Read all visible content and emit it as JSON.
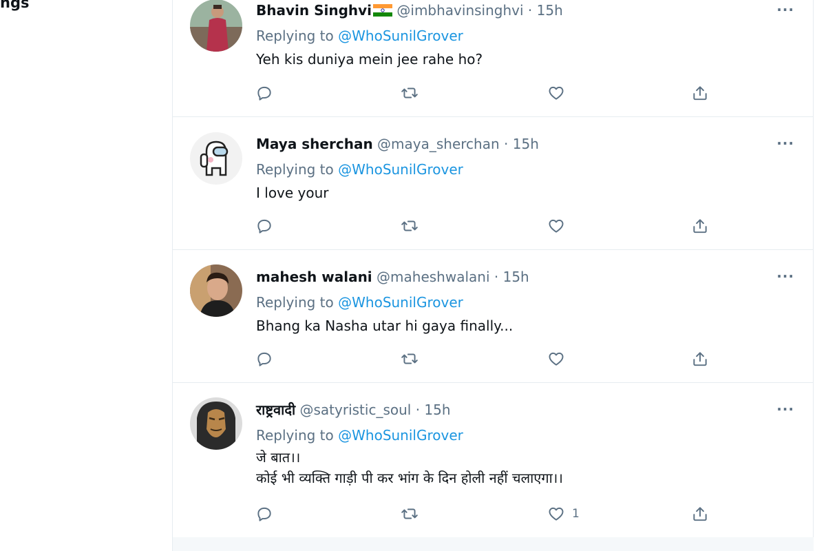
{
  "left_fragment": "ngs",
  "tweets": [
    {
      "name": "Bhavin Singhvi",
      "handle": "@imbhavinsinghvi",
      "dot": "·",
      "time": "15h",
      "replying_prefix": "Replying to ",
      "replying_to": "@WhoSunilGrover",
      "lines": [
        "Yeh kis duniya mein jee rahe ho?"
      ],
      "like_count": ""
    },
    {
      "name": "Maya sherchan",
      "handle": "@maya_sherchan",
      "dot": "·",
      "time": "15h",
      "replying_prefix": "Replying to ",
      "replying_to": "@WhoSunilGrover",
      "lines": [
        "I love your"
      ],
      "like_count": ""
    },
    {
      "name": "mahesh walani",
      "handle": "@maheshwalani",
      "dot": "·",
      "time": "15h",
      "replying_prefix": "Replying to ",
      "replying_to": "@WhoSunilGrover",
      "lines": [
        "Bhang ka Nasha utar hi gaya finally..."
      ],
      "like_count": ""
    },
    {
      "name": "राष्ट्रवादी",
      "handle": "@satyristic_soul",
      "dot": "·",
      "time": "15h",
      "replying_prefix": "Replying to ",
      "replying_to": "@WhoSunilGrover",
      "lines": [
        "जे बात।।",
        "कोई भी व्यक्ति गाड़ी पी कर भांग के दिन होली नहीं चलाएगा।।"
      ],
      "like_count": "1"
    }
  ],
  "icons": {
    "reply": "reply-icon",
    "retweet": "retweet-icon",
    "like": "like-icon",
    "share": "share-icon",
    "more": "more-icon",
    "flag": "india-flag-icon"
  },
  "colors": {
    "muted": "#5b7083",
    "link": "#1b95e0",
    "border": "#e6ecf0"
  }
}
